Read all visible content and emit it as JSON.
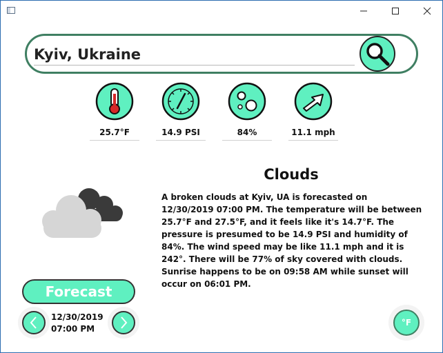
{
  "search": {
    "value": "Kyiv, Ukraine"
  },
  "stats": {
    "temperature": "25.7°F",
    "pressure": "14.9 PSI",
    "humidity": "84%",
    "wind": "11.1 mph"
  },
  "condition": {
    "title": "Clouds",
    "description": "A broken clouds at Kyiv, UA is forecasted on 12/30/2019 07:00 PM. The temperature will be between 25.7°F and 27.5°F, and it feels like it's 14.7°F. The pressure is presumed to be 14.9 PSI and humidity of 84%. The wind speed may be like 11.1 mph and it is 242°. There will be 77% of sky covered with clouds. Sunrise happens to be on 09:58 AM while sunset will occur on 06:01 PM."
  },
  "forecast": {
    "button_label": "Forecast",
    "date": "12/30/2019",
    "time": "07:00 PM"
  },
  "unit_toggle": {
    "label": "°F"
  },
  "icons": {
    "search": "magnifier-icon",
    "temperature": "thermometer-icon",
    "pressure": "gauge-icon",
    "humidity": "bubbles-icon",
    "wind": "arrow-icon",
    "weather": "cloud-icon",
    "prev": "chevron-left-icon",
    "next": "chevron-right-icon"
  },
  "colors": {
    "accent": "#5ff0c0",
    "border": "#3f7f62",
    "thermometer": "#d62828"
  }
}
